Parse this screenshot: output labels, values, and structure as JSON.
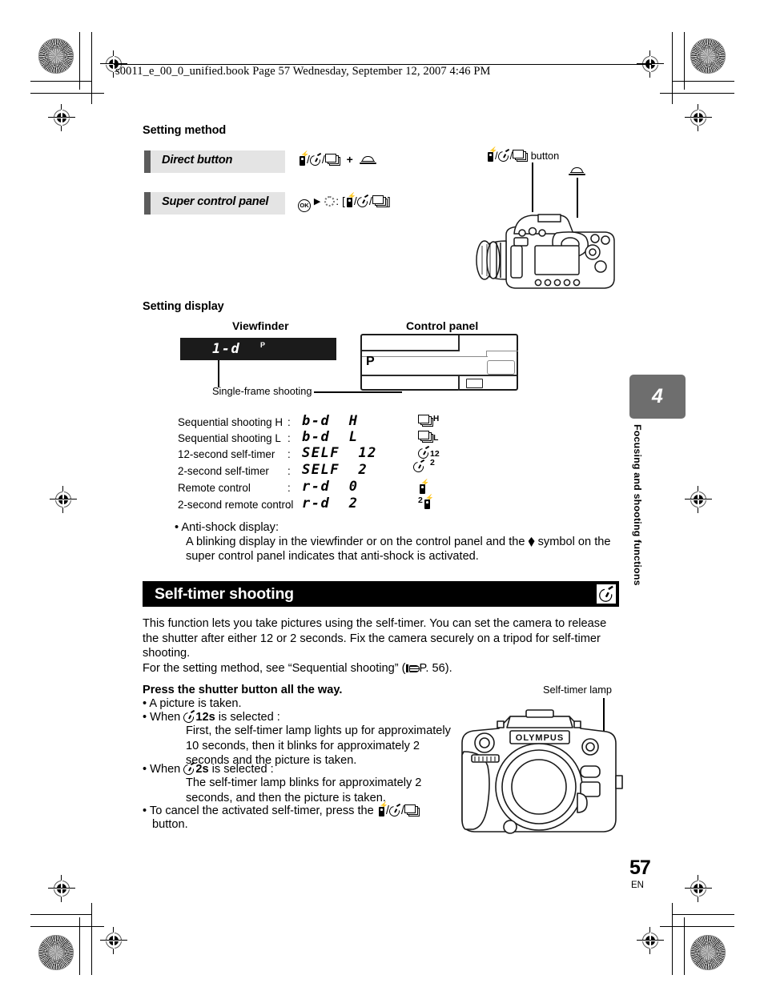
{
  "header": {
    "book_line": "s0011_e_00_0_unified.book  Page 57  Wednesday, September 12, 2007  4:46 PM"
  },
  "setting_method": {
    "heading": "Setting method",
    "rows": [
      {
        "label": "Direct button",
        "value_icons": "flash-selftimer-sequential + main-dial"
      },
      {
        "label": "Super control panel",
        "value_icons": "ok > arrow-pad : [flash-selftimer-sequential]"
      }
    ]
  },
  "top_camera": {
    "button_callout": "button",
    "button_icon_name": "flash-selftimer-sequential-button",
    "dial_icon_name": "main-dial"
  },
  "setting_display": {
    "heading": "Setting display",
    "viewfinder_caption": "Viewfinder",
    "control_panel_caption": "Control panel",
    "viewfinder_code": "1-d",
    "viewfinder_mode": "P",
    "panel_mode": "P",
    "leader_label": "Single-frame shooting"
  },
  "mode_list": [
    {
      "name": "Sequential shooting H",
      "colon": ":",
      "code": "b-d",
      "suffix": "H",
      "icon": "sequential-h-icon"
    },
    {
      "name": "Sequential shooting L",
      "colon": ":",
      "code": "b-d",
      "suffix": "L",
      "icon": "sequential-l-icon"
    },
    {
      "name": "12-second self-timer",
      "colon": ":",
      "code": "SELF",
      "suffix": "12",
      "icon": "self-timer-12-icon"
    },
    {
      "name": "2-second self-timer",
      "colon": ":",
      "code": "SELF",
      "suffix": "2",
      "icon": "self-timer-2-icon"
    },
    {
      "name": "Remote control",
      "colon": ":",
      "code": "r-d",
      "suffix": "0",
      "icon": "remote-control-icon"
    },
    {
      "name": "2-second remote control",
      "colon": ":",
      "code": "r-d",
      "suffix": "2",
      "icon": "remote-control-2-icon"
    }
  ],
  "anti_shock": {
    "bullet": "•",
    "title": "Anti-shock display:",
    "line1_a": "A blinking display in the viewfinder or on the control panel and the",
    "line1_b": "symbol on the",
    "line2": "super control panel indicates that anti-shock is activated."
  },
  "section": {
    "title": "Self-timer shooting",
    "icon_name": "self-timer-icon",
    "paragraph_1": "This function lets you take pictures using the self-timer. You can set the camera to release the shutter after either 12 or 2 seconds. Fix the camera securely on a tripod for self-timer shooting.",
    "paragraph_2_a": "For the setting method, see “Sequential shooting” (",
    "paragraph_2_b": "P. 56)."
  },
  "steps": {
    "heading": "Press the shutter button all the way.",
    "bullet": "•",
    "items": [
      {
        "text": "A picture is taken."
      },
      {
        "text_a": "When",
        "bold": "12s",
        "text_b": "is selected :",
        "detail": "First, the self-timer lamp lights up for approximately 10 seconds, then it blinks for approximately 2 seconds and the picture is taken."
      },
      {
        "text_a": "When",
        "bold": "2s",
        "text_b": "is selected  :",
        "detail": "The self-timer lamp blinks for approximately 2 seconds, and then the picture is taken."
      },
      {
        "text_a": "To cancel the activated self-timer, press the",
        "text_b": "button."
      }
    ]
  },
  "bottom_camera": {
    "callout": "Self-timer lamp",
    "brand": "OLYMPUS"
  },
  "chapter_tab": {
    "number": "4",
    "title": "Focusing and shooting functions"
  },
  "page": {
    "number": "57",
    "lang": "EN"
  },
  "colors": {
    "tab_gray": "#6e6e6e",
    "bar_gray": "#5c5c5c",
    "box_gray": "#e4e4e4",
    "banner_black": "#000000"
  }
}
